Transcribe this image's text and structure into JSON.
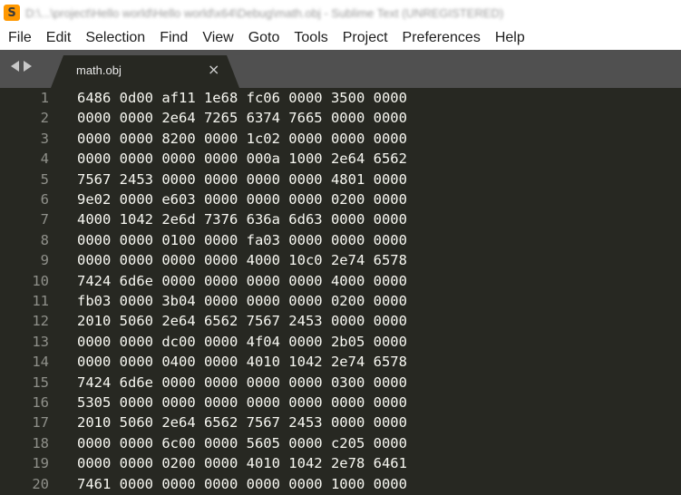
{
  "window": {
    "app_icon_letter": "S",
    "title": "D:\\...\\project\\Hello world\\Hello world\\x64\\Debug\\math.obj - Sublime Text (UNREGISTERED)"
  },
  "menu": [
    "File",
    "Edit",
    "Selection",
    "Find",
    "View",
    "Goto",
    "Tools",
    "Project",
    "Preferences",
    "Help"
  ],
  "tab": {
    "label": "math.obj",
    "close_glyph": "×"
  },
  "colors": {
    "editor_bg": "#272822",
    "text": "#f8f8f2",
    "line_number": "#8f908a",
    "tabbar_bg": "#505050",
    "app_icon": "#ff9800"
  },
  "lines": [
    {
      "n": "1",
      "text": "6486 0d00 af11 1e68 fc06 0000 3500 0000"
    },
    {
      "n": "2",
      "text": "0000 0000 2e64 7265 6374 7665 0000 0000"
    },
    {
      "n": "3",
      "text": "0000 0000 8200 0000 1c02 0000 0000 0000"
    },
    {
      "n": "4",
      "text": "0000 0000 0000 0000 000a 1000 2e64 6562"
    },
    {
      "n": "5",
      "text": "7567 2453 0000 0000 0000 0000 4801 0000"
    },
    {
      "n": "6",
      "text": "9e02 0000 e603 0000 0000 0000 0200 0000"
    },
    {
      "n": "7",
      "text": "4000 1042 2e6d 7376 636a 6d63 0000 0000"
    },
    {
      "n": "8",
      "text": "0000 0000 0100 0000 fa03 0000 0000 0000"
    },
    {
      "n": "9",
      "text": "0000 0000 0000 0000 4000 10c0 2e74 6578"
    },
    {
      "n": "10",
      "text": "7424 6d6e 0000 0000 0000 0000 4000 0000"
    },
    {
      "n": "11",
      "text": "fb03 0000 3b04 0000 0000 0000 0200 0000"
    },
    {
      "n": "12",
      "text": "2010 5060 2e64 6562 7567 2453 0000 0000"
    },
    {
      "n": "13",
      "text": "0000 0000 dc00 0000 4f04 0000 2b05 0000"
    },
    {
      "n": "14",
      "text": "0000 0000 0400 0000 4010 1042 2e74 6578"
    },
    {
      "n": "15",
      "text": "7424 6d6e 0000 0000 0000 0000 0300 0000"
    },
    {
      "n": "16",
      "text": "5305 0000 0000 0000 0000 0000 0000 0000"
    },
    {
      "n": "17",
      "text": "2010 5060 2e64 6562 7567 2453 0000 0000"
    },
    {
      "n": "18",
      "text": "0000 0000 6c00 0000 5605 0000 c205 0000"
    },
    {
      "n": "19",
      "text": "0000 0000 0200 0000 4010 1042 2e78 6461"
    },
    {
      "n": "20",
      "text": "7461 0000 0000 0000 0000 0000 1000 0000"
    }
  ]
}
